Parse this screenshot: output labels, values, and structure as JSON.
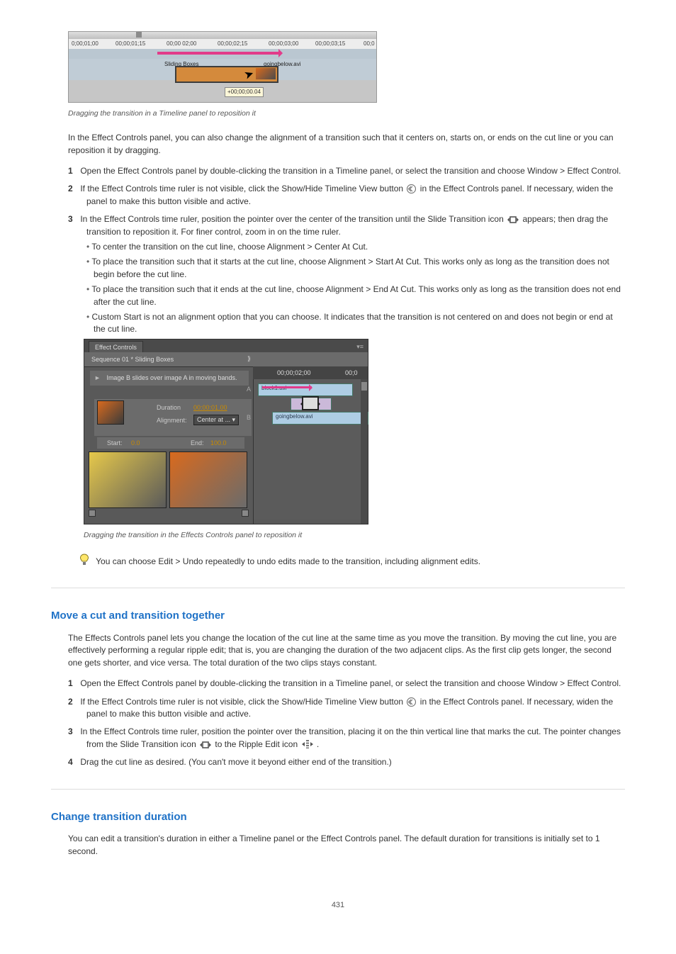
{
  "timeline_img": {
    "ruler": [
      "0;00;01;00",
      "00;00;01;15",
      "00;00 02;00",
      "00;00;02;15",
      "00;00;03;00",
      "00;00;03;15",
      "00;0"
    ],
    "clip_a": "Sliding Boxes",
    "clip_b": "goingbelow.avi",
    "tooltip": "+00;00;00.04"
  },
  "caption1": "Dragging the transition in a Timeline panel to reposition it",
  "para_effect": "In the Effect Controls panel, you can also change the alignment of a transition such that it centers on, starts on, or ends on the cut line or you can reposition it by dragging.",
  "step1_num": "1",
  "step1": "Open the Effect Controls panel by double-clicking the transition in a Timeline panel, or select the transition and choose Window > Effect Control.",
  "step2_num": "2",
  "step2a": "If the Effect Controls time ruler is not visible, click the Show/Hide Timeline View button ",
  "step2b": " in the Effect Controls panel. If necessary, widen the panel to make this button visible and active.",
  "step3_num": "3",
  "step3a": "In the Effect Controls time ruler, position the pointer over the center of the transition until the Slide Transition icon ",
  "step3b": " appears; then drag the transition to reposition it. For finer control, zoom in on the time ruler.",
  "b1": "To center the transition on the cut line, choose Alignment > Center At Cut.",
  "b2": "To place the transition such that it starts at the cut line, choose Alignment > Start At Cut. This works only as long as the transition does not begin before the cut line.",
  "b3": "To place the transition such that it ends at the cut line, choose Alignment > End At Cut. This works only as long as the transition does not end after the cut line.",
  "b4": "Custom Start is not an alignment option that you can choose. It indicates that the transition is not centered on and does not begin or end at the cut line.",
  "ec_img": {
    "tab": "Effect Controls",
    "menu": "▾≡",
    "path": "Sequence 01 * Sliding Boxes",
    "desc": "Image B slides over image A in moving bands.",
    "dur_label": "Duration",
    "dur_value": "00:00:01.00",
    "ali_label": "Alignment:",
    "ali_value": "Center at ... ▾",
    "start_label": "Start:",
    "start_value": "0.0",
    "end_label": "End:",
    "end_value": "100.0",
    "tc1": "00;00;02;00",
    "tc2": "00;0",
    "trackA": "A",
    "trackB": "B",
    "barA": "block1.avi",
    "barB": "goingbelow.avi"
  },
  "caption2": "Dragging the transition in the Effects Controls panel to reposition it",
  "tip": "You can choose Edit > Undo repeatedly to undo edits made to the transition, including alignment edits.",
  "sect2_title": "Move a cut and transition together",
  "sect2_p1": "The Effects Controls panel lets you change the location of the cut line at the same time as you move the transition. By moving the cut line, you are effectively performing a regular ripple edit; that is, you are changing the duration of the two adjacent clips. As the first clip gets longer, the second one gets shorter, and vice versa. The total duration of the two clips stays constant.",
  "s2_1_num": "1",
  "s2_1": "Open the Effect Controls panel by double-clicking the transition in a Timeline panel, or select the transition and choose Window > Effect Control.",
  "s2_2_num": "2",
  "s2_2a": "If the Effect Controls time ruler is not visible, click the Show/Hide Timeline View button ",
  "s2_2b": " in the Effect Controls panel. If necessary, widen the panel to make this button visible and active.",
  "s2_3_num": "3",
  "s2_3a": "In the Effect Controls time ruler, position the pointer over the transition, placing it on the thin vertical line that marks the cut. The pointer changes from the Slide Transition icon ",
  "s2_3b": " to the Ripple Edit icon ",
  "s2_3c": ".",
  "s2_4_num": "4",
  "s2_4": "Drag the cut line as desired. (You can't move it beyond either end of the transition.)",
  "sect3_title": "Change transition duration",
  "sect3_p": "You can edit a transition's duration in either a Timeline panel or the Effect Controls panel. The default duration for transitions is initially set to 1 second.",
  "page_no": "431"
}
